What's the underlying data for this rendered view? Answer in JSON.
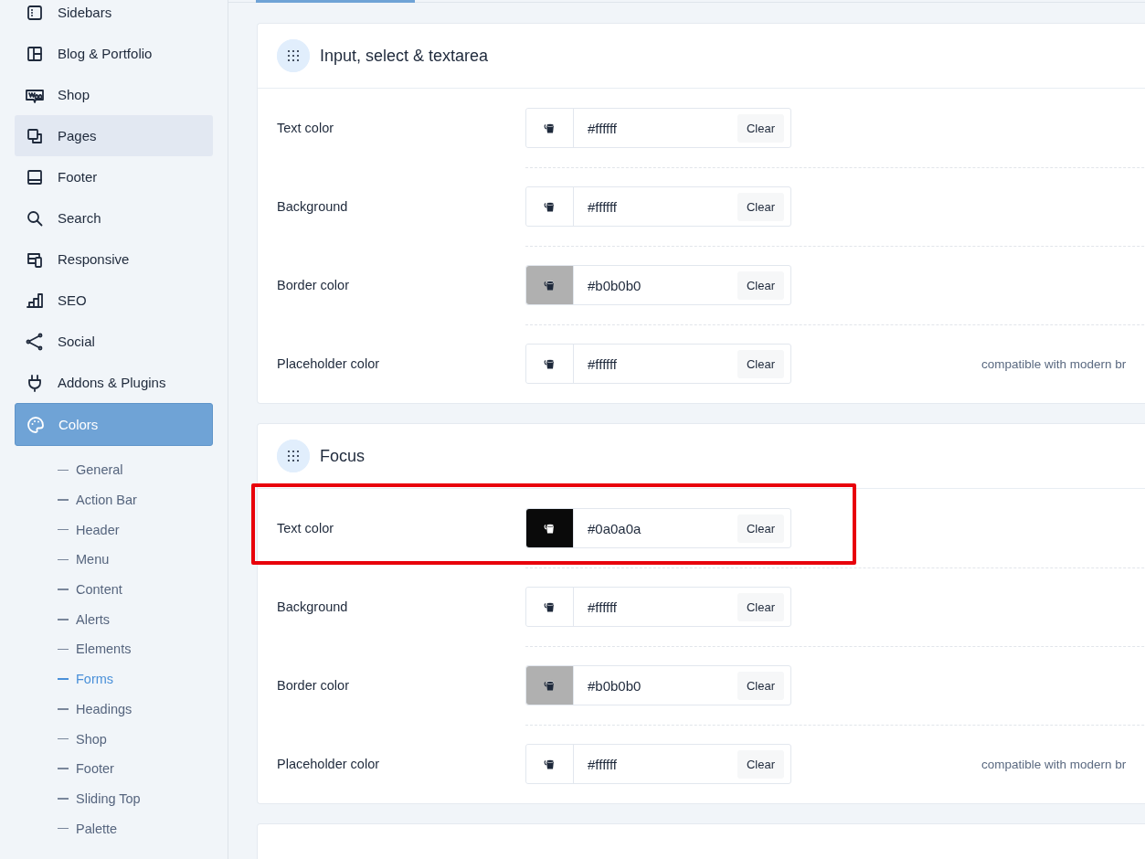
{
  "sidebar": {
    "items": [
      {
        "label": "Sidebars",
        "selected": false,
        "highlighted": false
      },
      {
        "label": "Blog & Portfolio",
        "selected": false,
        "highlighted": false
      },
      {
        "label": "Shop",
        "selected": false,
        "highlighted": false
      },
      {
        "label": "Pages",
        "selected": false,
        "highlighted": true
      },
      {
        "label": "Footer",
        "selected": false,
        "highlighted": false
      },
      {
        "label": "Search",
        "selected": false,
        "highlighted": false
      },
      {
        "label": "Responsive",
        "selected": false,
        "highlighted": false
      },
      {
        "label": "SEO",
        "selected": false,
        "highlighted": false
      },
      {
        "label": "Social",
        "selected": false,
        "highlighted": false
      },
      {
        "label": "Addons & Plugins",
        "selected": false,
        "highlighted": false
      },
      {
        "label": "Colors",
        "selected": true,
        "highlighted": false
      }
    ],
    "subitems": [
      {
        "label": "General",
        "selected": false
      },
      {
        "label": "Action Bar",
        "selected": false
      },
      {
        "label": "Header",
        "selected": false
      },
      {
        "label": "Menu",
        "selected": false
      },
      {
        "label": "Content",
        "selected": false
      },
      {
        "label": "Alerts",
        "selected": false
      },
      {
        "label": "Elements",
        "selected": false
      },
      {
        "label": "Forms",
        "selected": true
      },
      {
        "label": "Headings",
        "selected": false
      },
      {
        "label": "Shop",
        "selected": false
      },
      {
        "label": "Footer",
        "selected": false
      },
      {
        "label": "Sliding Top",
        "selected": false
      },
      {
        "label": "Palette",
        "selected": false
      }
    ]
  },
  "sections": [
    {
      "title": "Input, select & textarea",
      "rows": [
        {
          "label": "Text color",
          "value": "#ffffff",
          "button": "Clear",
          "highlighted": false
        },
        {
          "label": "Background",
          "value": "#ffffff",
          "button": "Clear",
          "highlighted": false
        },
        {
          "label": "Border color",
          "value": "#b0b0b0",
          "button": "Clear",
          "highlighted": false
        },
        {
          "label": "Placeholder color",
          "value": "#ffffff",
          "button": "Clear",
          "note": "compatible with modern br",
          "highlighted": false
        }
      ]
    },
    {
      "title": "Focus",
      "rows": [
        {
          "label": "Text color",
          "value": "#0a0a0a",
          "button": "Clear",
          "highlighted": true
        },
        {
          "label": "Background",
          "value": "#ffffff",
          "button": "Clear",
          "highlighted": false
        },
        {
          "label": "Border color",
          "value": "#b0b0b0",
          "button": "Clear",
          "highlighted": false
        },
        {
          "label": "Placeholder color",
          "value": "#ffffff",
          "button": "Clear",
          "note": "compatible with modern br",
          "highlighted": false
        }
      ]
    }
  ]
}
